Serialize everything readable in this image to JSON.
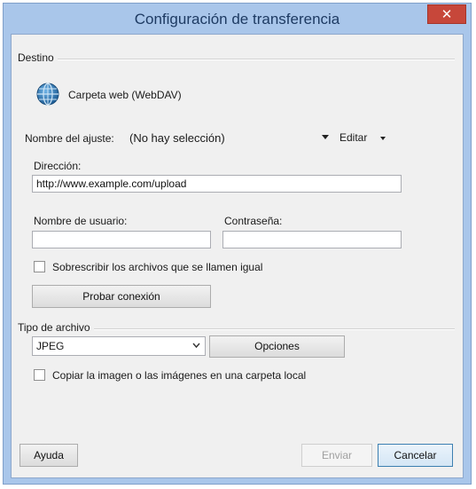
{
  "window": {
    "title": "Configuración de transferencia",
    "close_glyph": "✕"
  },
  "destination": {
    "group_label": "Destino",
    "type_label": "Carpeta web (WebDAV)",
    "setting_name_label": "Nombre del ajuste:",
    "setting_name_value": "(No hay selección)",
    "edit_label": "Editar",
    "address_label": "Dirección:",
    "address_value": "http://www.example.com/upload",
    "username_label": "Nombre de usuario:",
    "username_value": "",
    "password_label": "Contraseña:",
    "password_value": "",
    "overwrite_label": "Sobrescribir los archivos que se llamen igual",
    "overwrite_checked": false,
    "test_button": "Probar conexión"
  },
  "file_type": {
    "group_label": "Tipo de archivo",
    "selected": "JPEG",
    "options_button": "Opciones",
    "copy_label": "Copiar la imagen o las imágenes en una carpeta local",
    "copy_checked": false
  },
  "footer": {
    "help": "Ayuda",
    "send": "Enviar",
    "cancel": "Cancelar"
  },
  "icons": {
    "webdav": "globe-icon",
    "close": "close-icon",
    "dropdown": "chevron-down-icon"
  },
  "colors": {
    "frame": "#a9c6ea",
    "title_text": "#1e3b63",
    "close_button": "#c7473a",
    "globe": "#1f6fa8"
  }
}
